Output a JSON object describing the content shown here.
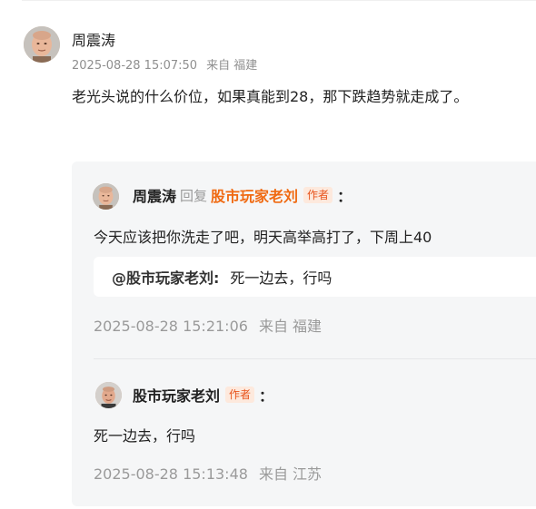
{
  "comment": {
    "author": "周震涛",
    "time": "2025-08-28 15:07:50",
    "location": "来自 福建",
    "text": "老光头说的什么价位，如果真能到28，那下跌趋势就走成了。"
  },
  "replies": [
    {
      "author": "周震涛",
      "reply_word": "回复",
      "target": "股市玩家老刘",
      "author_tag": "作者",
      "colon": "：",
      "text": "今天应该把你洗走了吧，明天高举高打了，下周上40",
      "quote": {
        "user": "@股市玩家老刘:",
        "text": "死一边去，行吗"
      },
      "time": "2025-08-28 15:21:06",
      "location": "来自 福建"
    },
    {
      "author": "股市玩家老刘",
      "author_tag": "作者",
      "colon": "：",
      "text": "死一边去，行吗",
      "time": "2025-08-28 15:13:48",
      "location": "来自 江苏"
    }
  ],
  "colors": {
    "accent_orange": "#f06a12",
    "author_tag_bg": "#fde9dd",
    "panel_bg": "#f5f6f7",
    "meta_gray": "#9a9a9a"
  }
}
